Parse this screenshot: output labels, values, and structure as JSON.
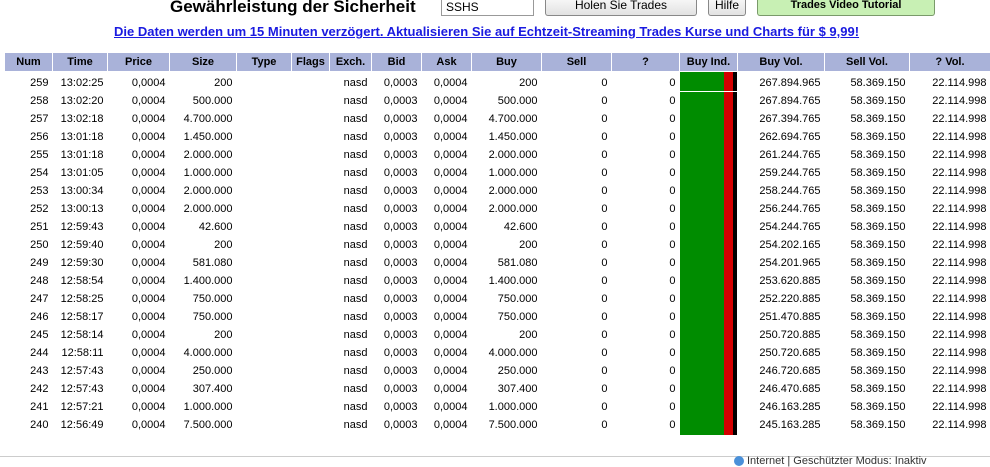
{
  "header": {
    "title": "Gewährleistung der Sicherheit",
    "symbol_value": "SSHS",
    "get_trades_label": "Holen Sie Trades",
    "help_label": "Hilfe",
    "video_label": "Trades Video Tutorial"
  },
  "notice": "Die Daten werden um 15 Minuten verzögert. Aktualisieren Sie auf Echtzeit-Streaming Trades Kurse und Charts für $ 9,99!",
  "table": {
    "columns": [
      "Num",
      "Time",
      "Price",
      "Size",
      "Type",
      "Flags",
      "Exch.",
      "Bid",
      "Ask",
      "Buy",
      "Sell",
      "?",
      "Buy Ind.",
      "Buy Vol.",
      "Sell Vol.",
      "? Vol."
    ],
    "rows": [
      {
        "num": "259",
        "time": "13:02:25",
        "price": "0,0004",
        "size": "200",
        "type": "",
        "flags": "",
        "exch": "nasd",
        "bid": "0,0003",
        "ask": "0,0004",
        "buy": "200",
        "sell": "0",
        "q": "0",
        "buyvol": "267.894.965",
        "sellvol": "58.369.150",
        "qvol": "22.114.998"
      },
      {
        "num": "258",
        "time": "13:02:20",
        "price": "0,0004",
        "size": "500.000",
        "type": "",
        "flags": "",
        "exch": "nasd",
        "bid": "0,0003",
        "ask": "0,0004",
        "buy": "500.000",
        "sell": "0",
        "q": "0",
        "buyvol": "267.894.765",
        "sellvol": "58.369.150",
        "qvol": "22.114.998"
      },
      {
        "num": "257",
        "time": "13:02:18",
        "price": "0,0004",
        "size": "4.700.000",
        "type": "",
        "flags": "",
        "exch": "nasd",
        "bid": "0,0003",
        "ask": "0,0004",
        "buy": "4.700.000",
        "sell": "0",
        "q": "0",
        "buyvol": "267.394.765",
        "sellvol": "58.369.150",
        "qvol": "22.114.998"
      },
      {
        "num": "256",
        "time": "13:01:18",
        "price": "0,0004",
        "size": "1.450.000",
        "type": "",
        "flags": "",
        "exch": "nasd",
        "bid": "0,0003",
        "ask": "0,0004",
        "buy": "1.450.000",
        "sell": "0",
        "q": "0",
        "buyvol": "262.694.765",
        "sellvol": "58.369.150",
        "qvol": "22.114.998"
      },
      {
        "num": "255",
        "time": "13:01:18",
        "price": "0,0004",
        "size": "2.000.000",
        "type": "",
        "flags": "",
        "exch": "nasd",
        "bid": "0,0003",
        "ask": "0,0004",
        "buy": "2.000.000",
        "sell": "0",
        "q": "0",
        "buyvol": "261.244.765",
        "sellvol": "58.369.150",
        "qvol": "22.114.998"
      },
      {
        "num": "254",
        "time": "13:01:05",
        "price": "0,0004",
        "size": "1.000.000",
        "type": "",
        "flags": "",
        "exch": "nasd",
        "bid": "0,0003",
        "ask": "0,0004",
        "buy": "1.000.000",
        "sell": "0",
        "q": "0",
        "buyvol": "259.244.765",
        "sellvol": "58.369.150",
        "qvol": "22.114.998"
      },
      {
        "num": "253",
        "time": "13:00:34",
        "price": "0,0004",
        "size": "2.000.000",
        "type": "",
        "flags": "",
        "exch": "nasd",
        "bid": "0,0003",
        "ask": "0,0004",
        "buy": "2.000.000",
        "sell": "0",
        "q": "0",
        "buyvol": "258.244.765",
        "sellvol": "58.369.150",
        "qvol": "22.114.998"
      },
      {
        "num": "252",
        "time": "13:00:13",
        "price": "0,0004",
        "size": "2.000.000",
        "type": "",
        "flags": "",
        "exch": "nasd",
        "bid": "0,0003",
        "ask": "0,0004",
        "buy": "2.000.000",
        "sell": "0",
        "q": "0",
        "buyvol": "256.244.765",
        "sellvol": "58.369.150",
        "qvol": "22.114.998"
      },
      {
        "num": "251",
        "time": "12:59:43",
        "price": "0,0004",
        "size": "42.600",
        "type": "",
        "flags": "",
        "exch": "nasd",
        "bid": "0,0003",
        "ask": "0,0004",
        "buy": "42.600",
        "sell": "0",
        "q": "0",
        "buyvol": "254.244.765",
        "sellvol": "58.369.150",
        "qvol": "22.114.998"
      },
      {
        "num": "250",
        "time": "12:59:40",
        "price": "0,0004",
        "size": "200",
        "type": "",
        "flags": "",
        "exch": "nasd",
        "bid": "0,0003",
        "ask": "0,0004",
        "buy": "200",
        "sell": "0",
        "q": "0",
        "buyvol": "254.202.165",
        "sellvol": "58.369.150",
        "qvol": "22.114.998"
      },
      {
        "num": "249",
        "time": "12:59:30",
        "price": "0,0004",
        "size": "581.080",
        "type": "",
        "flags": "",
        "exch": "nasd",
        "bid": "0,0003",
        "ask": "0,0004",
        "buy": "581.080",
        "sell": "0",
        "q": "0",
        "buyvol": "254.201.965",
        "sellvol": "58.369.150",
        "qvol": "22.114.998"
      },
      {
        "num": "248",
        "time": "12:58:54",
        "price": "0,0004",
        "size": "1.400.000",
        "type": "",
        "flags": "",
        "exch": "nasd",
        "bid": "0,0003",
        "ask": "0,0004",
        "buy": "1.400.000",
        "sell": "0",
        "q": "0",
        "buyvol": "253.620.885",
        "sellvol": "58.369.150",
        "qvol": "22.114.998"
      },
      {
        "num": "247",
        "time": "12:58:25",
        "price": "0,0004",
        "size": "750.000",
        "type": "",
        "flags": "",
        "exch": "nasd",
        "bid": "0,0003",
        "ask": "0,0004",
        "buy": "750.000",
        "sell": "0",
        "q": "0",
        "buyvol": "252.220.885",
        "sellvol": "58.369.150",
        "qvol": "22.114.998"
      },
      {
        "num": "246",
        "time": "12:58:17",
        "price": "0,0004",
        "size": "750.000",
        "type": "",
        "flags": "",
        "exch": "nasd",
        "bid": "0,0003",
        "ask": "0,0004",
        "buy": "750.000",
        "sell": "0",
        "q": "0",
        "buyvol": "251.470.885",
        "sellvol": "58.369.150",
        "qvol": "22.114.998"
      },
      {
        "num": "245",
        "time": "12:58:14",
        "price": "0,0004",
        "size": "200",
        "type": "",
        "flags": "",
        "exch": "nasd",
        "bid": "0,0003",
        "ask": "0,0004",
        "buy": "200",
        "sell": "0",
        "q": "0",
        "buyvol": "250.720.885",
        "sellvol": "58.369.150",
        "qvol": "22.114.998"
      },
      {
        "num": "244",
        "time": "12:58:11",
        "price": "0,0004",
        "size": "4.000.000",
        "type": "",
        "flags": "",
        "exch": "nasd",
        "bid": "0,0003",
        "ask": "0,0004",
        "buy": "4.000.000",
        "sell": "0",
        "q": "0",
        "buyvol": "250.720.685",
        "sellvol": "58.369.150",
        "qvol": "22.114.998"
      },
      {
        "num": "243",
        "time": "12:57:43",
        "price": "0,0004",
        "size": "250.000",
        "type": "",
        "flags": "",
        "exch": "nasd",
        "bid": "0,0003",
        "ask": "0,0004",
        "buy": "250.000",
        "sell": "0",
        "q": "0",
        "buyvol": "246.720.685",
        "sellvol": "58.369.150",
        "qvol": "22.114.998"
      },
      {
        "num": "242",
        "time": "12:57:43",
        "price": "0,0004",
        "size": "307.400",
        "type": "",
        "flags": "",
        "exch": "nasd",
        "bid": "0,0003",
        "ask": "0,0004",
        "buy": "307.400",
        "sell": "0",
        "q": "0",
        "buyvol": "246.470.685",
        "sellvol": "58.369.150",
        "qvol": "22.114.998"
      },
      {
        "num": "241",
        "time": "12:57:21",
        "price": "0,0004",
        "size": "1.000.000",
        "type": "",
        "flags": "",
        "exch": "nasd",
        "bid": "0,0003",
        "ask": "0,0004",
        "buy": "1.000.000",
        "sell": "0",
        "q": "0",
        "buyvol": "246.163.285",
        "sellvol": "58.369.150",
        "qvol": "22.114.998"
      },
      {
        "num": "240",
        "time": "12:56:49",
        "price": "0,0004",
        "size": "7.500.000",
        "type": "",
        "flags": "",
        "exch": "nasd",
        "bid": "0,0003",
        "ask": "0,0004",
        "buy": "7.500.000",
        "sell": "0",
        "q": "0",
        "buyvol": "245.163.285",
        "sellvol": "58.369.150",
        "qvol": "22.114.998"
      }
    ]
  },
  "buy_indicator": {
    "buy_share": 0.77,
    "sell_share": 0.15,
    "q_share": 0.08,
    "colors": {
      "buy": "#008c00",
      "sell": "#d40000",
      "q": "#000000"
    }
  },
  "statusbar": {
    "text": "Internet | Geschützter Modus: Inaktiv"
  }
}
